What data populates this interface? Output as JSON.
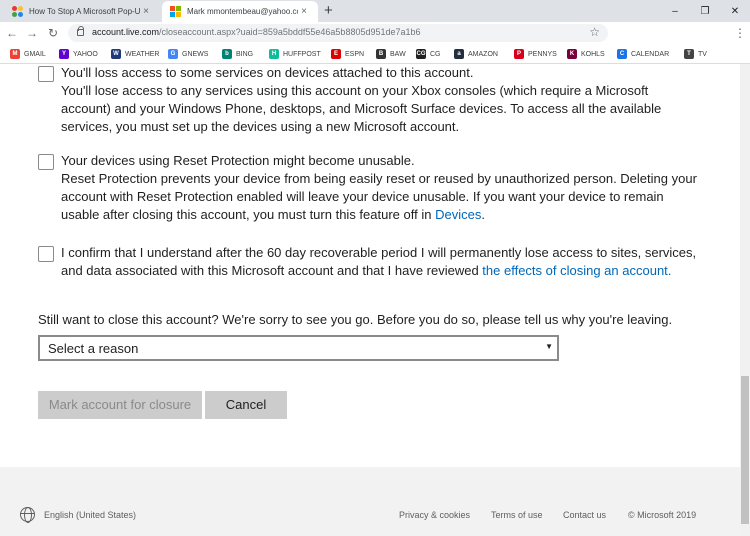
{
  "browser": {
    "tabs": [
      {
        "title": "How To Stop A Microsoft Pop-Up",
        "close": "×"
      },
      {
        "title": "Mark mmontembeau@yahoo.co",
        "close": "×"
      }
    ],
    "new_tab": "+",
    "window_controls": {
      "minimize": "–",
      "restore": "❐",
      "close": "✕"
    },
    "nav": {
      "back": "←",
      "forward": "→",
      "reload": "↻"
    },
    "url_host": "account.live.com",
    "url_rest": "/closeaccount.aspx?uaid=859a5bddf55e46a5b8805d951de7a1b6",
    "star": "☆",
    "extensions": [
      {
        "glyph": "▶",
        "color": "#e31b23"
      },
      {
        "glyph": "z",
        "color": "#1a73e8"
      },
      {
        "glyph": "+",
        "color": "#34a853"
      },
      {
        "glyph": "●",
        "color": "#5f6368"
      },
      {
        "glyph": "✉",
        "color": "#5f6368"
      },
      {
        "glyph": "",
        "color": "#8d6e63"
      }
    ],
    "menu": "⋮"
  },
  "bookmarks": [
    {
      "label": "GMAIL",
      "icon": "gmail-icon",
      "glyph": "M",
      "color": "#ea4335"
    },
    {
      "label": "YAHOO",
      "icon": "yahoo-icon",
      "glyph": "Y",
      "color": "#6001d2"
    },
    {
      "label": "WEATHER",
      "icon": "weather-icon",
      "glyph": "W",
      "color": "#1e3a78"
    },
    {
      "label": "GNEWS",
      "icon": "gnews-icon",
      "glyph": "G",
      "color": "#4285f4"
    },
    {
      "label": "BING",
      "icon": "bing-icon",
      "glyph": "b",
      "color": "#008373"
    },
    {
      "label": "HUFFPOST",
      "icon": "huffpost-icon",
      "glyph": "H",
      "color": "#0dbe98"
    },
    {
      "label": "ESPN",
      "icon": "espn-icon",
      "glyph": "E",
      "color": "#d00"
    },
    {
      "label": "BAW",
      "icon": "baw-icon",
      "glyph": "B",
      "color": "#333"
    },
    {
      "label": "CG",
      "icon": "cg-icon",
      "glyph": "CG",
      "color": "#222"
    },
    {
      "label": "AMAZON",
      "icon": "amazon-icon",
      "glyph": "a",
      "color": "#232f3e"
    },
    {
      "label": "PENNYS",
      "icon": "pennys-icon",
      "glyph": "P",
      "color": "#d6001c"
    },
    {
      "label": "KOHLS",
      "icon": "kohls-icon",
      "glyph": "K",
      "color": "#7a003c"
    },
    {
      "label": "CALENDAR",
      "icon": "calendar-icon",
      "glyph": "C",
      "color": "#1a73e8"
    },
    {
      "label": "TV",
      "icon": "tv-icon",
      "glyph": "T",
      "color": "#444"
    }
  ],
  "page": {
    "items": [
      {
        "head": "You'll loss access to some services on devices attached to this account.",
        "desc": "You'll lose access to any services using this account on your Xbox consoles (which require a Microsoft account) and your Windows Phone, desktops, and Microsoft Surface devices. To access all the available services, you must set up the devices using a new Microsoft account."
      },
      {
        "head": "Your devices using Reset Protection might become unusable.",
        "desc": "Reset Protection prevents your device from being easily reset or reused by unauthorized person. Deleting your account with Reset Protection enabled will leave your device unusable. If you want your device to remain usable after closing this account, you must turn this feature off in ",
        "link": "Devices",
        "tail": "."
      },
      {
        "desc": "I confirm that I understand after the 60 day recoverable period I will permanently lose access to sites, services, and data associated with this Microsoft account and that I have reviewed ",
        "link": "the effects of closing an account.",
        "tail": ""
      }
    ],
    "question": "Still want to close this account? We're sorry to see you go. Before you do so, please tell us why you're leaving.",
    "select_value": "Select a reason",
    "select_arrow": "▼",
    "primary_button": "Mark account for closure",
    "secondary_button": "Cancel"
  },
  "footer": {
    "language": "English (United States)",
    "links": [
      "Privacy & cookies",
      "Terms of use",
      "Contact us",
      "© Microsoft 2019"
    ]
  }
}
